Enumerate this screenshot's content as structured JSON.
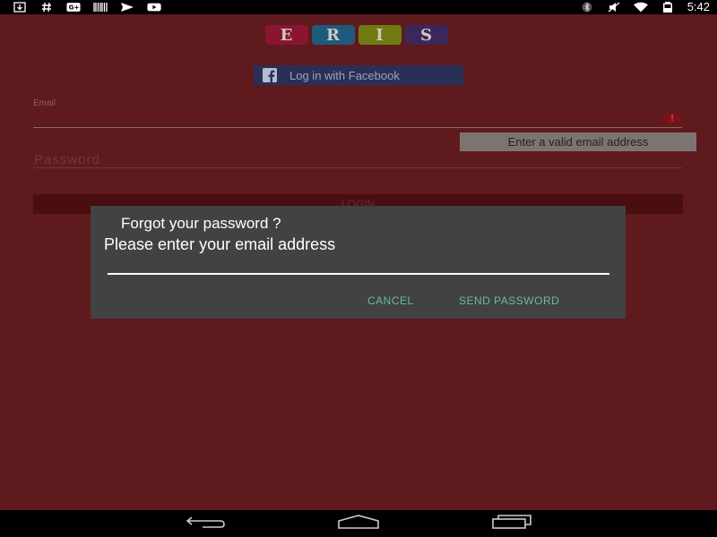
{
  "status_bar": {
    "time": "5:42",
    "left_icons": [
      "download-icon",
      "hash-icon",
      "google-plus-icon",
      "barcode-icon",
      "send-icon",
      "youtube-icon"
    ],
    "right_icons": [
      "bluetooth-icon",
      "mute-icon",
      "wifi-icon",
      "battery-icon"
    ]
  },
  "logo": {
    "letters": [
      {
        "char": "E",
        "color": "#8a1530"
      },
      {
        "char": "R",
        "color": "#1d5a7c"
      },
      {
        "char": "I",
        "color": "#6f7a12"
      },
      {
        "char": "S",
        "color": "#3a285a"
      }
    ]
  },
  "login": {
    "facebook_label": "Log in with Facebook",
    "email_label": "Email",
    "error_tooltip": "Enter a valid email address",
    "password_hint": "Password",
    "login_label": "LOGIN"
  },
  "dialog": {
    "title": "Forgot your password ?",
    "message": "Please enter your email address",
    "input_value": "",
    "cancel_label": "CANCEL",
    "send_label": "SEND PASSWORD"
  },
  "colors": {
    "background": "#5e1a1d",
    "dialog": "#424242",
    "dialog_button": "#6bb8ac",
    "facebook": "#2a2f58"
  }
}
